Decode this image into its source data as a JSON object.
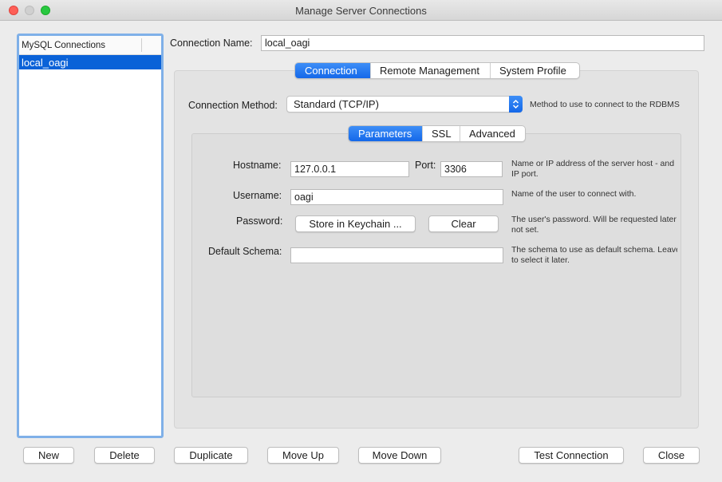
{
  "window": {
    "title": "Manage Server Connections"
  },
  "sidebar": {
    "header": "MySQL Connections",
    "items": [
      {
        "label": "local_oagi",
        "selected": true
      }
    ]
  },
  "connection_name": {
    "label": "Connection Name:",
    "value": "local_oagi"
  },
  "main_tabs": [
    {
      "label": "Connection",
      "active": true
    },
    {
      "label": "Remote Management",
      "active": false
    },
    {
      "label": "System Profile",
      "active": false
    }
  ],
  "connection_method": {
    "label": "Connection Method:",
    "value": "Standard (TCP/IP)",
    "hint": "Method to use to connect to the RDBMS"
  },
  "sub_tabs": [
    {
      "label": "Parameters",
      "active": true
    },
    {
      "label": "SSL",
      "active": false
    },
    {
      "label": "Advanced",
      "active": false
    }
  ],
  "params": {
    "hostname": {
      "label": "Hostname:",
      "value": "127.0.0.1"
    },
    "port": {
      "label": "Port:",
      "value": "3306"
    },
    "hostname_hint_1": "Name or IP address of the server host - and",
    "hostname_hint_2": "IP port.",
    "username": {
      "label": "Username:",
      "value": "oagi",
      "hint": "Name of the user to connect with."
    },
    "password": {
      "label": "Password:",
      "store_button": "Store in Keychain ...",
      "clear_button": "Clear",
      "hint_1": "The user's password. Will be requested later",
      "hint_2": "not set."
    },
    "default_schema": {
      "label": "Default Schema:",
      "value": "",
      "hint_1": "The schema to use as default schema. Leave",
      "hint_2": "to select it later."
    }
  },
  "buttons": {
    "new": "New",
    "delete": "Delete",
    "duplicate": "Duplicate",
    "move_up": "Move Up",
    "move_down": "Move Down",
    "test_connection": "Test Connection",
    "close": "Close"
  },
  "colors": {
    "accent": "#1468e9",
    "selection": "#0a62d8",
    "window_bg": "#ececec"
  }
}
